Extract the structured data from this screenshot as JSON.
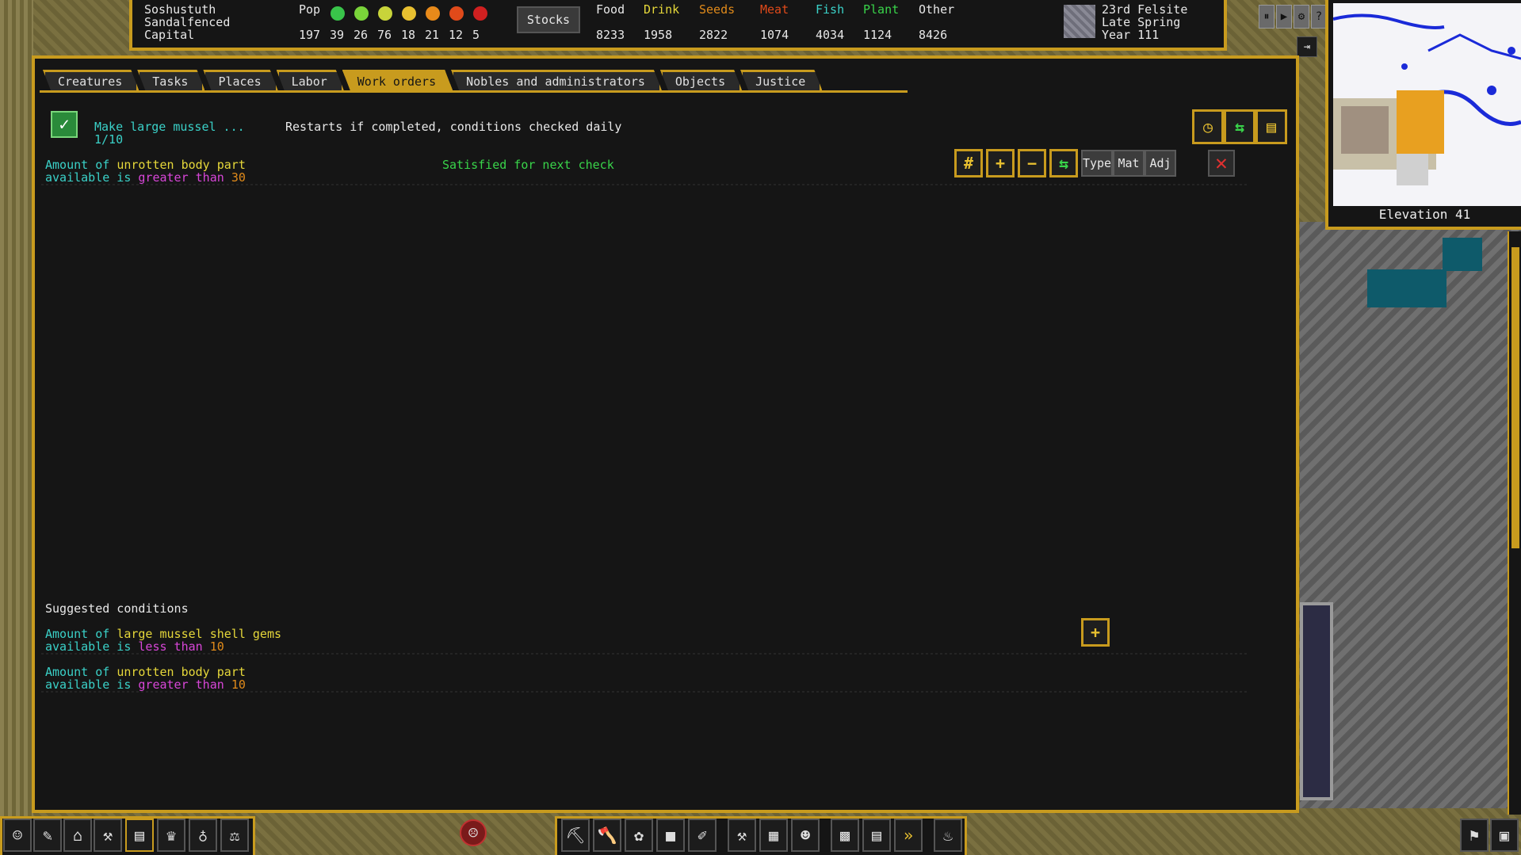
{
  "fortress": {
    "name": "Soshustuth",
    "translation": "Sandalfenced",
    "type": "Capital"
  },
  "population": {
    "label": "Pop",
    "total": "197",
    "moods": [
      "39",
      "26",
      "76",
      "18",
      "21",
      "12",
      "5"
    ],
    "mood_colors": [
      "#39c44a",
      "#7ad43a",
      "#c8d43a",
      "#e8c030",
      "#e88a1a",
      "#e04a1a",
      "#d02020"
    ]
  },
  "stocks_button": "Stocks",
  "stocks": [
    {
      "label": "Food",
      "value": "8233",
      "color": "#e8e8e8"
    },
    {
      "label": "Drink",
      "value": "1958",
      "color": "#e6d83a"
    },
    {
      "label": "Seeds",
      "value": "2822",
      "color": "#e08a1a"
    },
    {
      "label": "Meat",
      "value": "1074",
      "color": "#e04a1a"
    },
    {
      "label": "Fish",
      "value": "4034",
      "color": "#3ad1c8"
    },
    {
      "label": "Plant",
      "value": "1124",
      "color": "#39d44a"
    },
    {
      "label": "Other",
      "value": "8426",
      "color": "#e8e8e8"
    }
  ],
  "date": {
    "day": "23rd Felsite",
    "season": "Late Spring",
    "year": "Year 111"
  },
  "controls": {
    "pause": "⏸",
    "play": "▶",
    "settings": "⚙",
    "help": "?"
  },
  "minimap": {
    "elevation": "Elevation 41"
  },
  "tabs": [
    {
      "label": "Creatures",
      "active": false
    },
    {
      "label": "Tasks",
      "active": false
    },
    {
      "label": "Places",
      "active": false
    },
    {
      "label": "Labor",
      "active": false
    },
    {
      "label": "Work orders",
      "active": true
    },
    {
      "label": "Nobles and administrators",
      "active": false
    },
    {
      "label": "Objects",
      "active": false
    },
    {
      "label": "Justice",
      "active": false
    }
  ],
  "order": {
    "name": "Make large mussel ...",
    "progress": "1/10",
    "frequency": "Restarts if completed, conditions checked daily"
  },
  "condition": {
    "line1_a": "Amount of ",
    "line1_b": "unrotten body part",
    "line2_a": "available is ",
    "line2_b": "greater than ",
    "line2_c": "30",
    "status": "Satisfied for next check"
  },
  "condition_buttons": {
    "hash": "#",
    "plus": "+",
    "minus": "−",
    "type": "Type",
    "mat": "Mat",
    "adj": "Adj",
    "close": "✕"
  },
  "suggested": {
    "header": "Suggested conditions",
    "items": [
      {
        "a": "Amount of ",
        "b": "large mussel shell gems",
        "c": "available is ",
        "d": "less than ",
        "e": "10"
      },
      {
        "a": "Amount of ",
        "b": "unrotten body part",
        "c": "available is ",
        "d": "greater than ",
        "e": "10"
      }
    ],
    "add": "+"
  }
}
